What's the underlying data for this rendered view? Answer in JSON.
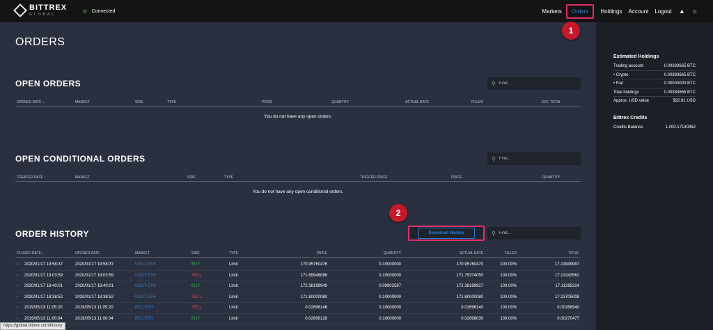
{
  "brand": {
    "name": "BITTREX",
    "sub": "GLOBAL"
  },
  "connection": {
    "status": "Connected",
    "icon": "wifi-icon",
    "color": "#2fb34a"
  },
  "nav": [
    {
      "label": "Markets",
      "active": false
    },
    {
      "label": "Orders",
      "active": true
    },
    {
      "label": "Holdings",
      "active": false
    },
    {
      "label": "Account",
      "active": false
    },
    {
      "label": "Logout",
      "active": false
    }
  ],
  "page_title": "ORDERS",
  "open_orders": {
    "title": "OPEN ORDERS",
    "search_placeholder": "Find...",
    "columns": [
      "OPENED DATE",
      "MARKET",
      "SIDE",
      "TYPE",
      "PRICE",
      "QUANTITY",
      "ACTUAL RATE",
      "FILLED",
      "EST. TOTAL"
    ],
    "empty_text": "You do not have any open orders."
  },
  "conditional_orders": {
    "title": "OPEN CONDITIONAL ORDERS",
    "search_placeholder": "Find...",
    "columns": [
      "CREATED DATE",
      "MARKET",
      "SIDE",
      "TYPE",
      "TRIGGER PRICE",
      "PRICE",
      "QUANTITY"
    ],
    "empty_text": "You do not have any open conditional orders."
  },
  "order_history": {
    "title": "ORDER HISTORY",
    "download_label": "Download History",
    "search_placeholder": "Find...",
    "columns": [
      "CLOSED DATE",
      "OPENED DATE",
      "MARKET",
      "SIDE",
      "TYPE",
      "PRICE",
      "QUANTITY",
      "ACTUAL RATE",
      "FILLED",
      "TOTAL"
    ],
    "rows": [
      {
        "closed": "2020/01/17 19:58:37",
        "opened": "2020/01/17 19:58:37",
        "market": "USDT-ETH",
        "side": "BUY",
        "type": "Limit",
        "price": "170.95760476",
        "quantity": "0.10000000",
        "rate": "170.95760470",
        "filled": "100.00%",
        "total": "17.13849987"
      },
      {
        "closed": "2020/01/17 19:03:59",
        "opened": "2020/01/17 19:03:59",
        "market": "USDT-ETH",
        "side": "SELL",
        "type": "Limit",
        "price": "171.69946086",
        "quantity": "0.10000000",
        "rate": "171.75374050",
        "filled": "100.00%",
        "total": "17.13243562"
      },
      {
        "closed": "2020/01/17 18:40:01",
        "opened": "2020/01/17 18:40:01",
        "market": "USDT-ETH",
        "side": "BUY",
        "type": "Limit",
        "price": "172.38199949",
        "quantity": "0.09902587",
        "rate": "172.38199927",
        "filled": "100.00%",
        "total": "17.11295314"
      },
      {
        "closed": "2020/01/17 18:38:52",
        "opened": "2020/01/17 18:38:52",
        "market": "USDT-ETH",
        "side": "SELL",
        "type": "Limit",
        "price": "171.80000080",
        "quantity": "0.10000000",
        "rate": "171.80000080",
        "filled": "100.00%",
        "total": "17.13705008"
      },
      {
        "closed": "2019/05/13 11:05:20",
        "opened": "2019/05/13 11:05:20",
        "market": "BTC-ETH",
        "side": "SELL",
        "type": "Limit",
        "price": "0.02696146",
        "quantity": "0.10000000",
        "rate": "0.02696140",
        "filled": "100.00%",
        "total": "0.00268940"
      },
      {
        "closed": "2019/05/13 11:00:04",
        "opened": "2019/05/13 11:00:04",
        "market": "BTC-ETH",
        "side": "BUY",
        "type": "Limit",
        "price": "0.02698128",
        "quantity": "0.10000000",
        "rate": "0.02698030",
        "filled": "100.00%",
        "total": "0.00270477"
      }
    ]
  },
  "sidebar": {
    "holdings_title": "Estimated Holdings",
    "holdings": [
      {
        "label": "Trading account",
        "value": "0.00383665 BTC"
      },
      {
        "label": "• Crypto",
        "value": "0.00383665 BTC"
      },
      {
        "label": "• Fiat",
        "value": "0.00000000 BTC"
      },
      {
        "label": "Total holdings",
        "value": "0.00383665 BTC"
      },
      {
        "label": "Approx. USD value",
        "value": "$32.91 USD"
      }
    ],
    "credits_title": "Bittrex Credits",
    "credits": [
      {
        "label": "Credits Balance",
        "value": "1,000.17130352"
      }
    ]
  },
  "annotations": {
    "badge1": "1",
    "badge2": "2"
  },
  "status_url": "https://global.bittrex.com/history",
  "colors": {
    "accent": "#2e7fd6",
    "buy": "#2fb34a",
    "sell": "#e2434b",
    "highlight": "#e0306a",
    "badge": "#c4192b"
  }
}
